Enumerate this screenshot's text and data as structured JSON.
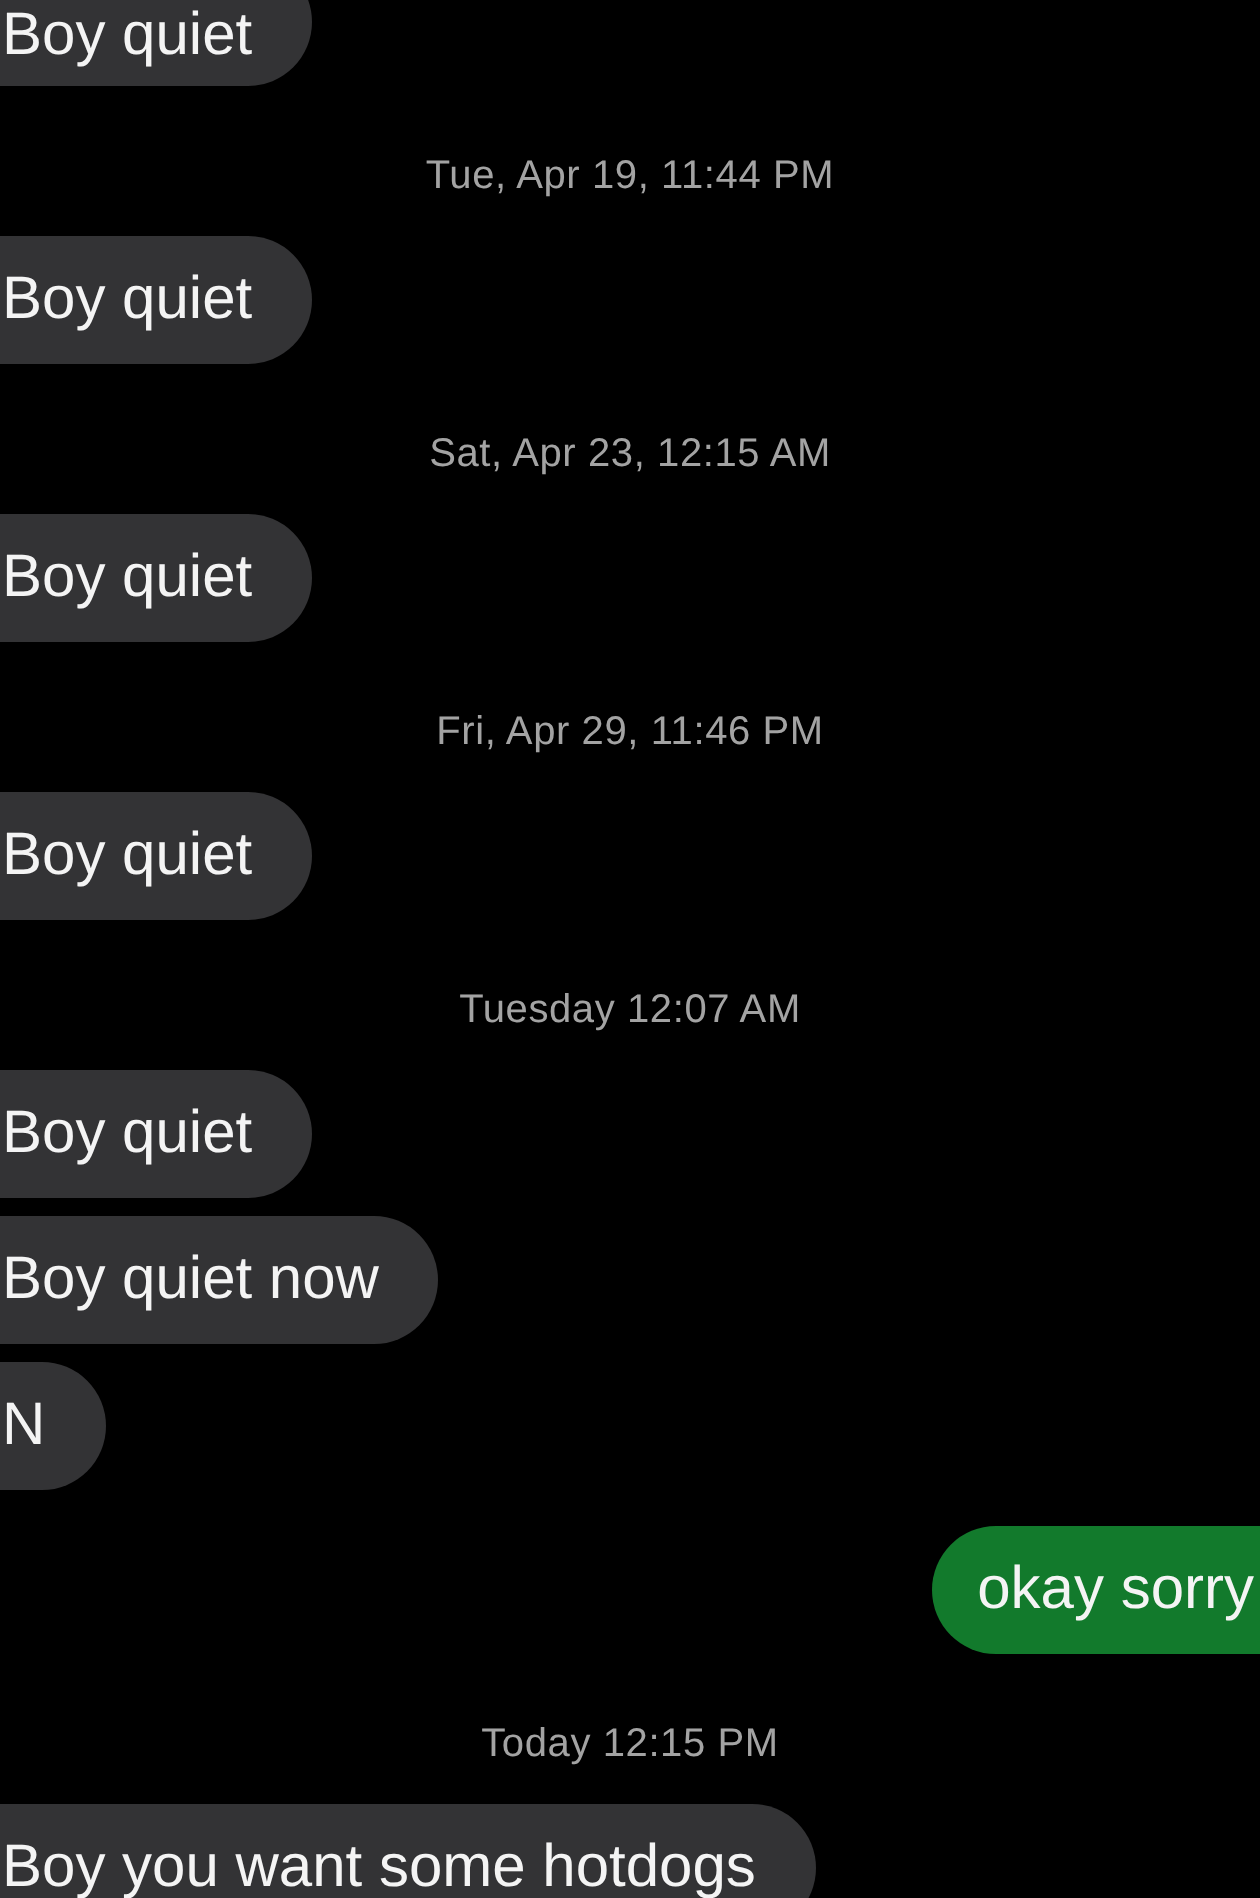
{
  "messages": [
    {
      "kind": "incoming",
      "text": "Boy quiet"
    },
    {
      "kind": "timestamp",
      "text": "Tue, Apr 19, 11:44 PM"
    },
    {
      "kind": "incoming",
      "text": "Boy quiet"
    },
    {
      "kind": "timestamp",
      "text": "Sat, Apr 23, 12:15 AM"
    },
    {
      "kind": "incoming",
      "text": "Boy quiet"
    },
    {
      "kind": "timestamp",
      "text": "Fri, Apr 29, 11:46 PM"
    },
    {
      "kind": "incoming",
      "text": "Boy quiet"
    },
    {
      "kind": "timestamp",
      "text": "Tuesday 12:07 AM"
    },
    {
      "kind": "incoming",
      "text": "Boy quiet"
    },
    {
      "kind": "incoming",
      "text": "Boy quiet now"
    },
    {
      "kind": "incoming",
      "text": "N"
    },
    {
      "kind": "outgoing",
      "text": "okay sorry"
    },
    {
      "kind": "timestamp",
      "text": "Today 12:15 PM"
    },
    {
      "kind": "incoming",
      "text": "Boy you want some hotdogs"
    }
  ]
}
